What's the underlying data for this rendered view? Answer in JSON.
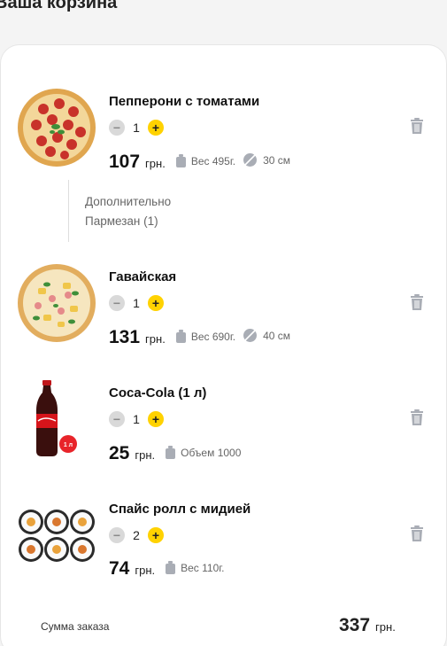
{
  "header": {
    "title": "Ваша корзина"
  },
  "cart": {
    "items": [
      {
        "name": "Пепперони с томатами",
        "quantity": "1",
        "price": "107",
        "currency": "грн.",
        "weight": "Вес 495г.",
        "size": "30 см",
        "extras_title": "Дополнительно",
        "extras": [
          "Пармезан (1)"
        ]
      },
      {
        "name": "Гавайская",
        "quantity": "1",
        "price": "131",
        "currency": "грн.",
        "weight": "Вес 690г.",
        "size": "40 см"
      },
      {
        "name": "Coca-Cola (1 л)",
        "quantity": "1",
        "price": "25",
        "currency": "грн.",
        "volume": "Объем 1000",
        "badge": "1 л"
      },
      {
        "name": "Спайс ролл с мидией",
        "quantity": "2",
        "price": "74",
        "currency": "грн.",
        "weight": "Вес 110г."
      }
    ],
    "summary": {
      "label": "Сумма заказа",
      "total": "337",
      "currency": "грн."
    }
  },
  "controls": {
    "minus": "−",
    "plus": "+"
  },
  "icons": {
    "weight": "weight-icon",
    "size": "diameter-icon",
    "delete": "trash-icon"
  },
  "colors": {
    "accent": "#ffd200",
    "muted": "#d9d9d9",
    "icon": "#a9adb5"
  }
}
